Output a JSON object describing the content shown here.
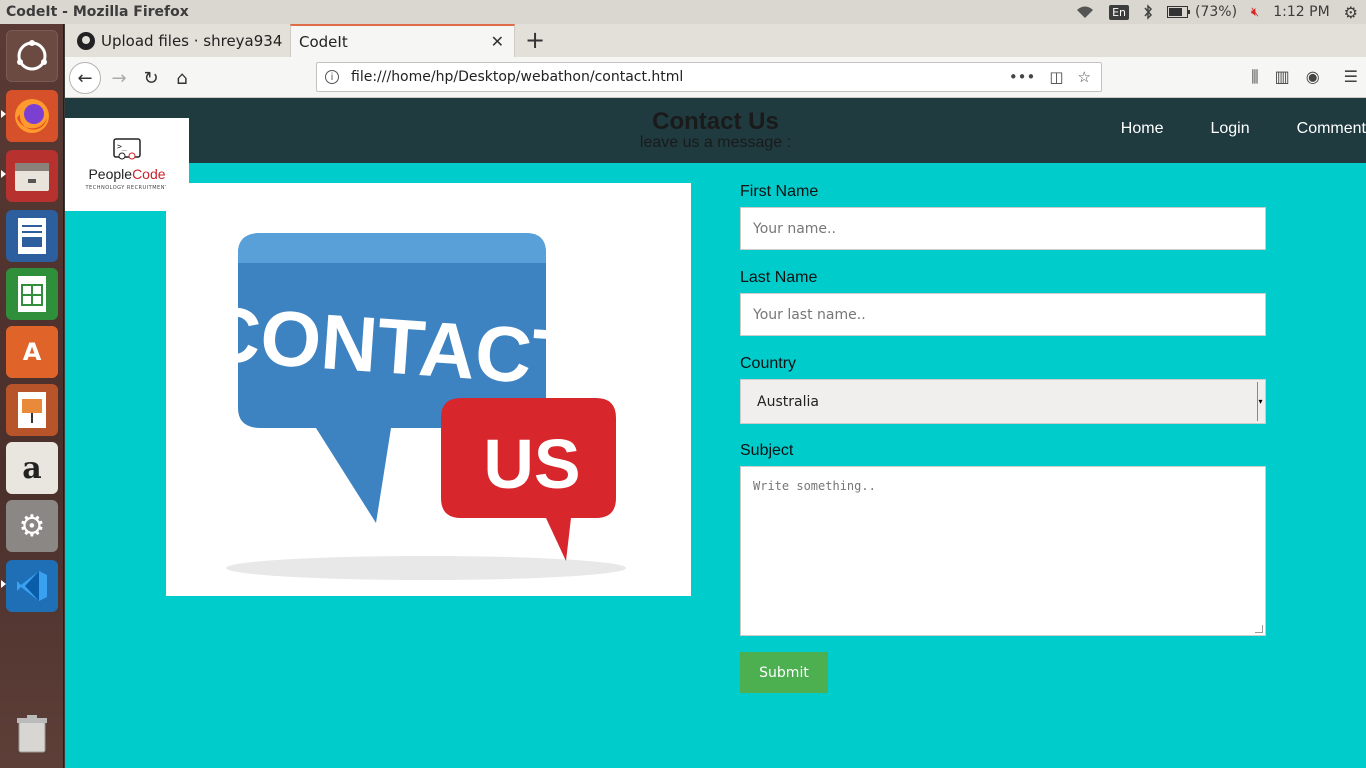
{
  "top_panel": {
    "window_title": "CodeIt - Mozilla Firefox",
    "keyboard": "En",
    "battery": "(73%)",
    "time": "1:12 PM"
  },
  "browser": {
    "tabs": [
      {
        "label": "Upload files · shreya934",
        "icon": "github-icon"
      },
      {
        "label": "CodeIt"
      }
    ],
    "url": "file:///home/hp/Desktop/webathon/contact.html"
  },
  "page": {
    "header": {
      "title": "Contact Us",
      "subtitle": "leave us a message :",
      "nav": [
        "Home",
        "Login",
        "Comment"
      ]
    },
    "logo": {
      "name_part1": "People",
      "name_part2": "Code",
      "tagline": "TECHNOLOGY RECRUITMENT"
    },
    "image_text": {
      "line1": "CONTACT",
      "line2": "US"
    },
    "form": {
      "first_name_label": "First Name",
      "first_name_placeholder": "Your name..",
      "last_name_label": "Last Name",
      "last_name_placeholder": "Your last name..",
      "country_label": "Country",
      "country_value": "Australia",
      "subject_label": "Subject",
      "subject_placeholder": "Write something..",
      "submit_label": "Submit"
    }
  },
  "colors": {
    "page_bg": "#00cccc",
    "header_bg": "#1f3b3f",
    "submit_bg": "#4caf50"
  }
}
